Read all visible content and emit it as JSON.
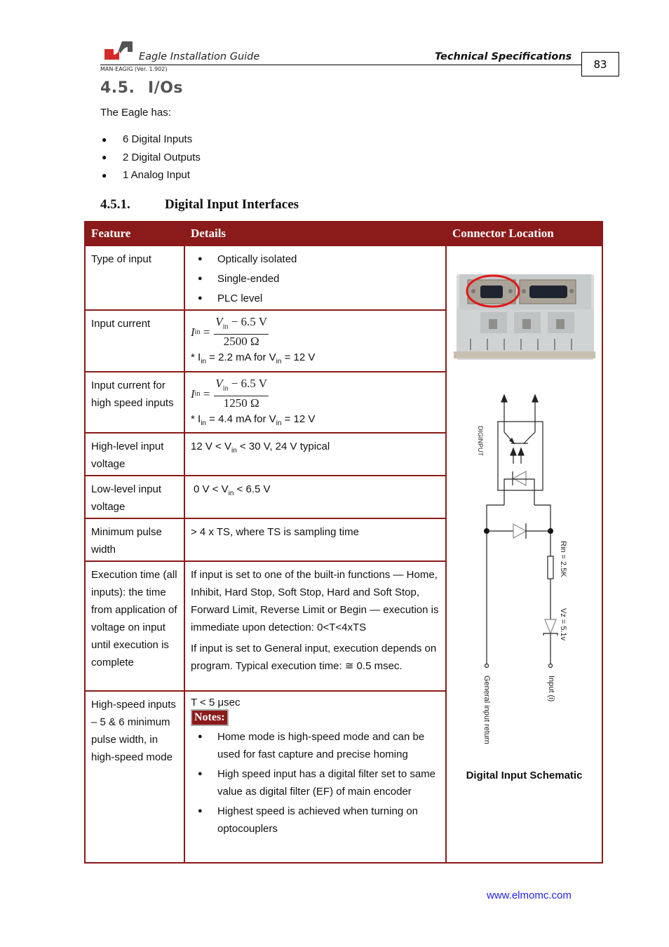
{
  "header": {
    "doc_title": "Eagle Installation Guide",
    "section_title": "Technical Specifications",
    "doc_version": "MAN-EAGIG (Ver. 1.902)",
    "page_number": "83",
    "logo_colors": {
      "red": "#d42a2a",
      "gray": "#555555"
    }
  },
  "section": {
    "number": "4.5.",
    "title": "I/Os",
    "intro": "The Eagle has:",
    "bullets": [
      "6 Digital Inputs",
      "2 Digital Outputs",
      "1 Analog Input"
    ]
  },
  "subsection": {
    "number": "4.5.1.",
    "title": "Digital Input Interfaces"
  },
  "table": {
    "accent_color": "#8b1a1a",
    "headers": [
      "Feature",
      "Details",
      "Connector Location"
    ],
    "rows": [
      {
        "feature": "Type of input",
        "details": [
          "Optically isolated",
          "Single-ended",
          "PLC level"
        ]
      },
      {
        "feature": "Input current",
        "formula": {
          "lhs": "I",
          "lhs_sub": "in",
          "eq": "=",
          "numerator": "V",
          "num_sub": "in",
          "num_rest": " − 6.5 V",
          "denominator": "2500 Ω"
        },
        "note": {
          "a": "* I",
          "a_sub": "in",
          "b": " = 2.2 mA for V",
          "b_sub": "in",
          "c": " = 12 V"
        }
      },
      {
        "feature": "Input current for high speed inputs",
        "formula": {
          "lhs": "I",
          "lhs_sub": "in",
          "eq": "=",
          "numerator": "V",
          "num_sub": "in",
          "num_rest": " − 6.5 V",
          "denominator": "1250 Ω"
        },
        "note": {
          "a": "* I",
          "a_sub": "in",
          "b": " = 4.4 mA for V",
          "b_sub": "in",
          "c": " = 12 V"
        }
      },
      {
        "feature": "High-level input voltage",
        "detail": {
          "a": "12 V < V",
          "sub": "in",
          "b": " < 30 V, 24 V typical"
        }
      },
      {
        "feature": "Low-level input voltage",
        "detail": {
          "a": " 0 V < V",
          "sub": "in",
          "b": " < 6.5 V"
        }
      },
      {
        "feature": "Minimum pulse width",
        "detail_text": "> 4 x TS, where TS is sampling time"
      },
      {
        "feature": "Execution time (all inputs): the time from application of voltage on input until execution is complete",
        "paragraphs": [
          "If input is set to one of the built-in functions — Home, Inhibit, Hard Stop, Soft Stop, Hard and Soft Stop, Forward Limit, Reverse Limit or Begin — execution is immediate upon detection: 0<T<4xTS",
          "If input is set to General input, execution depends on program. Typical execution time: ≅ 0.5 msec."
        ]
      },
      {
        "feature": "High-speed inputs – 5 & 6 minimum pulse width, in high-speed mode",
        "detail_text": "T < 5 μsec",
        "notes_label": "Notes:",
        "notes": [
          "Home mode is high-speed mode and can be used for fast capture and precise homing",
          "High speed input has a digital filter set to same value as digital filter (EF) of main encoder",
          "Highest speed is achieved when turning on optocouplers"
        ]
      }
    ]
  },
  "schematic": {
    "labels": {
      "diginput": "DIGINPUT",
      "rin": "Rin = 2.5K",
      "vz": "Vz = 5.1v",
      "general_return": "General input return",
      "input_i": "Input (i)"
    },
    "caption": "Digital Input Schematic"
  },
  "footer": {
    "website": "www.elmomc.com"
  }
}
